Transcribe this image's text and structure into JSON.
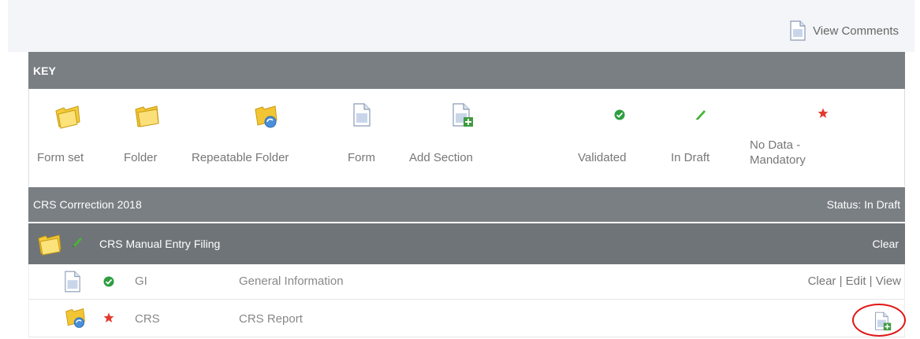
{
  "header": {
    "view_comments_label": "View Comments"
  },
  "key": {
    "title": "KEY",
    "items": [
      {
        "label": "Form set",
        "icon": "form-set-icon"
      },
      {
        "label": "Folder",
        "icon": "folder-icon"
      },
      {
        "label": "Repeatable Folder",
        "icon": "repeatable-folder-icon"
      },
      {
        "label": "Form",
        "icon": "form-icon"
      },
      {
        "label": "Add Section",
        "icon": "add-section-icon"
      },
      {
        "label": "Validated",
        "icon": "validated-icon"
      },
      {
        "label": "In Draft",
        "icon": "in-draft-icon"
      },
      {
        "label": "No Data - Mandatory",
        "icon": "no-data-mandatory-icon"
      }
    ]
  },
  "return": {
    "title": "CRS Corrrection 2018",
    "status": "Status: In Draft"
  },
  "filing": {
    "name": "CRS Manual Entry Filing",
    "clear_label": "Clear"
  },
  "rows": [
    {
      "code": "GI",
      "description": "General Information",
      "actions": [
        "Clear",
        "Edit",
        "View"
      ]
    },
    {
      "code": "CRS",
      "description": "CRS Report"
    }
  ],
  "colors": {
    "header_gray": "#7a7f84",
    "validated_green": "#2e9e3f",
    "draft_green": "#48b534",
    "mandatory_red": "#e23a2e",
    "highlight_red": "#e01515"
  }
}
